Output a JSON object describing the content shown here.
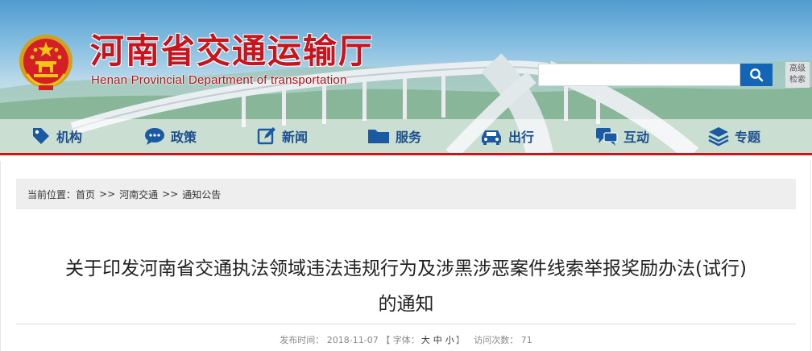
{
  "site": {
    "title": "河南省交通运输厅",
    "subtitle": "Henan Provincial Department of transportation"
  },
  "search": {
    "placeholder": "",
    "button_icon": "search-icon",
    "advanced_line1": "高级",
    "advanced_line2": "检索"
  },
  "nav": {
    "items": [
      {
        "label": "机构",
        "icon": "tag-icon"
      },
      {
        "label": "政策",
        "icon": "chat-bubble-icon"
      },
      {
        "label": "新闻",
        "icon": "edit-icon"
      },
      {
        "label": "服务",
        "icon": "folder-icon"
      },
      {
        "label": "出行",
        "icon": "car-icon"
      },
      {
        "label": "互动",
        "icon": "chat-icon"
      },
      {
        "label": "专题",
        "icon": "layers-icon"
      }
    ]
  },
  "breadcrumb": {
    "prefix": "当前位置：",
    "items": [
      "首页",
      "河南交通",
      "通知公告"
    ],
    "separator": ">>"
  },
  "article": {
    "title_line1": "关于印发河南省交通执法领域违法违规行为及涉黑涉恶案件线索举报奖励办法(试行)",
    "title_line2": "的通知",
    "published_label": "发布时间：",
    "published_date": "2018-11-07",
    "font_label_open": "【 字体：",
    "font_large": "大",
    "font_medium": "中",
    "font_small": "小",
    "font_label_close": "】",
    "visits_label": "访问次数：",
    "visits_count": "71"
  },
  "colors": {
    "brand_red": "#c8141c",
    "nav_blue": "#1b4f8f",
    "search_blue": "#1565b6"
  }
}
